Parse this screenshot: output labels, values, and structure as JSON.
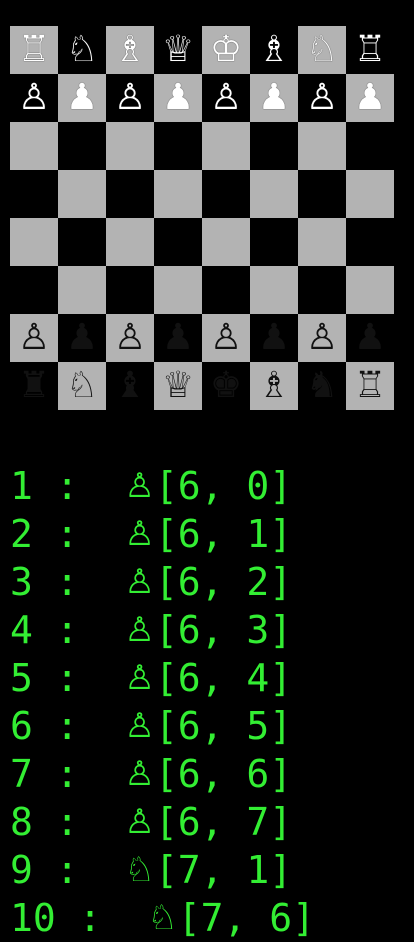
{
  "board": {
    "colors": {
      "light": "#b3b3b3",
      "dark": "#000000",
      "piece_top": "#ffffff",
      "piece_bottom": "#111111"
    },
    "ranks": [
      [
        "♖",
        "♘",
        "♗",
        "♕",
        "♔",
        "♗",
        "♘",
        "♖"
      ],
      [
        "♙",
        "♟",
        "♙",
        "♟",
        "♙",
        "♟",
        "♙",
        "♟"
      ],
      [
        "",
        "",
        "",
        "",
        "",
        "",
        "",
        ""
      ],
      [
        "",
        "",
        "",
        "",
        "",
        "",
        "",
        ""
      ],
      [
        "",
        "",
        "",
        "",
        "",
        "",
        "",
        ""
      ],
      [
        "",
        "",
        "",
        "",
        "",
        "",
        "",
        ""
      ],
      [
        "♙",
        "♟",
        "♙",
        "♟",
        "♙",
        "♟",
        "♙",
        "♟"
      ],
      [
        "♜",
        "♘",
        "♝",
        "♕",
        "♚",
        "♗",
        "♞",
        "♖"
      ]
    ]
  },
  "move_list": {
    "color": "#33ee33",
    "items": [
      {
        "index": "1",
        "sep": " : ",
        "piece": "♙",
        "coords": "[6, 0]"
      },
      {
        "index": "2",
        "sep": " : ",
        "piece": "♙",
        "coords": "[6, 1]"
      },
      {
        "index": "3",
        "sep": " : ",
        "piece": "♙",
        "coords": "[6, 2]"
      },
      {
        "index": "4",
        "sep": " : ",
        "piece": "♙",
        "coords": "[6, 3]"
      },
      {
        "index": "5",
        "sep": " : ",
        "piece": "♙",
        "coords": "[6, 4]"
      },
      {
        "index": "6",
        "sep": " : ",
        "piece": "♙",
        "coords": "[6, 5]"
      },
      {
        "index": "7",
        "sep": " : ",
        "piece": "♙",
        "coords": "[6, 6]"
      },
      {
        "index": "8",
        "sep": " : ",
        "piece": "♙",
        "coords": "[6, 7]"
      },
      {
        "index": "9",
        "sep": " : ",
        "piece": "♘",
        "coords": "[7, 1]"
      },
      {
        "index": "10",
        "sep": " : ",
        "piece": "♘",
        "coords": "[7, 6]"
      }
    ]
  }
}
